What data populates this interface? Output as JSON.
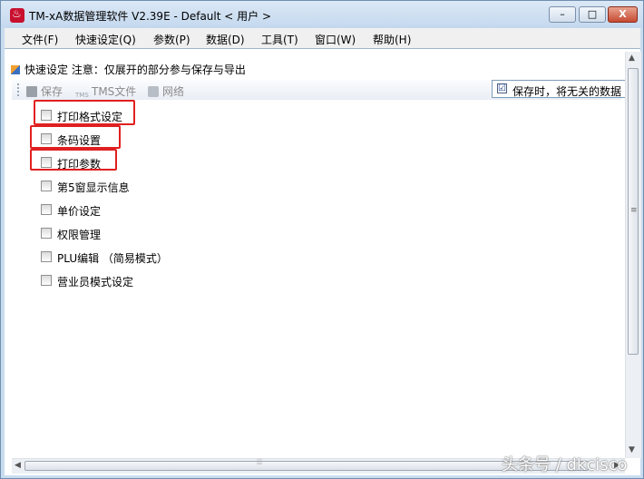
{
  "window": {
    "title": "TM-xA数据管理软件 V2.39E - Default < 用户 >",
    "controls": {
      "minimize": "–",
      "maximize": "□",
      "close": "X"
    }
  },
  "menu": [
    "文件(F)",
    "快速设定(Q)",
    "参数(P)",
    "数据(D)",
    "工具(T)",
    "窗口(W)",
    "帮助(H)"
  ],
  "panel": {
    "title": "快速设定  注意：仅展开的部分参与保存与导出"
  },
  "toolbar": {
    "save_label": "保存",
    "tms_label": "TMS文件",
    "tms_icon_text": "TMS",
    "network_label": "网络",
    "save_option_label": "保存时，将无关的数据",
    "save_option_mark": "☑"
  },
  "options": [
    {
      "label": "打印格式设定",
      "highlighted": true
    },
    {
      "label": "条码设置",
      "highlighted": true
    },
    {
      "label": "打印参数",
      "highlighted": true
    },
    {
      "label": "第5窗显示信息",
      "highlighted": false
    },
    {
      "label": "单价设定",
      "highlighted": false
    },
    {
      "label": "权限管理",
      "highlighted": false
    },
    {
      "label": "PLU编辑 （简易模式）",
      "highlighted": false
    },
    {
      "label": "营业员模式设定",
      "highlighted": false
    }
  ],
  "highlight_color": "#e02020",
  "watermark": "头条号 / dkcisco"
}
